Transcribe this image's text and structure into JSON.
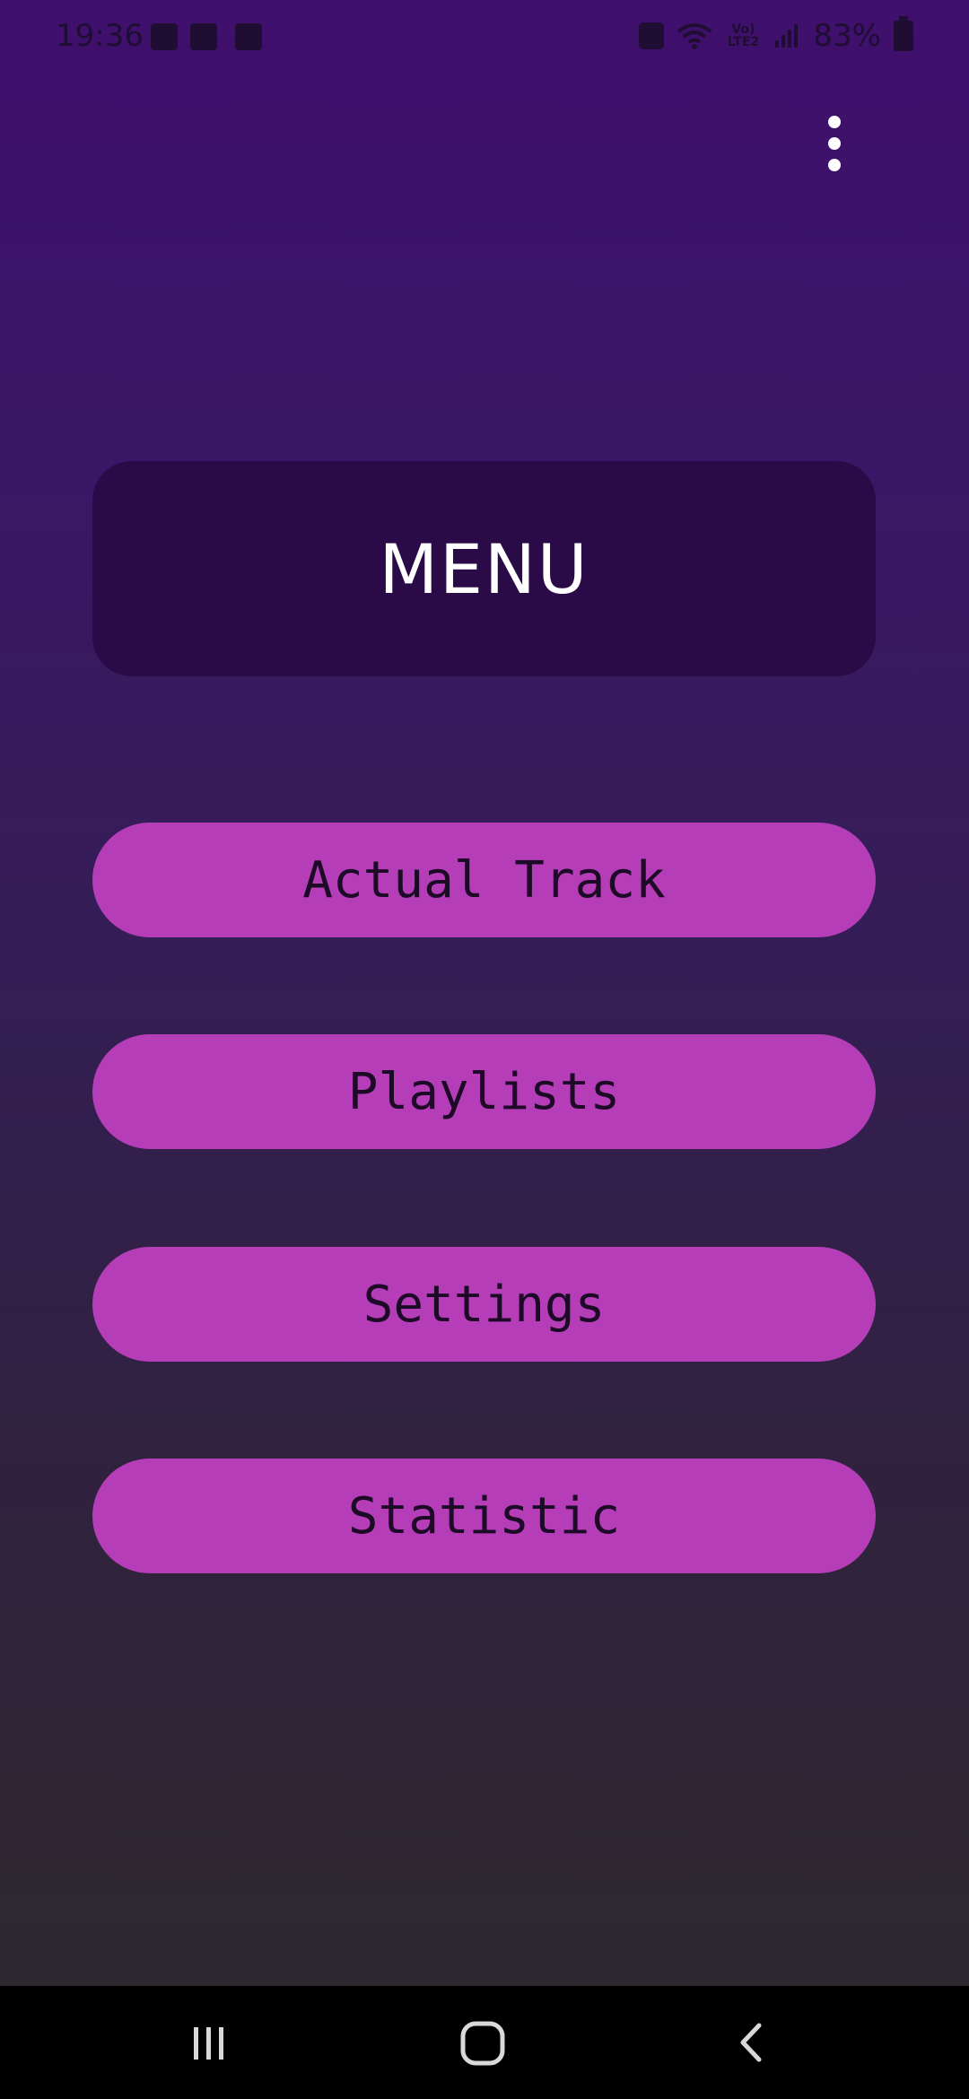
{
  "status_bar": {
    "time": "19:36",
    "lte_label": "Vo) LTE2",
    "battery": "83%"
  },
  "menu": {
    "title": "MENU",
    "buttons": [
      "Actual Track",
      "Playlists",
      "Settings",
      "Statistic"
    ]
  },
  "colors": {
    "background_top": "#3f0f6d",
    "background_bottom": "#2c2a2b",
    "title_card": "#2a0b48",
    "button": "#b53eb8",
    "button_text": "#1d0a26"
  },
  "icons": {
    "overflow": "more-vert-icon",
    "recents": "recents-icon",
    "home": "home-icon",
    "back": "back-icon"
  }
}
